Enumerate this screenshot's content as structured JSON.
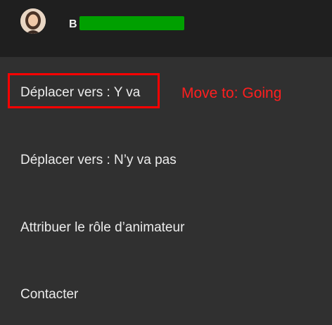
{
  "header": {
    "user_initial": "B",
    "avatar_icon": "user-avatar-photo"
  },
  "menu": {
    "items": [
      {
        "label": "Déplacer vers : Y va"
      },
      {
        "label": "Déplacer vers : N’y va pas"
      },
      {
        "label": "Attribuer le rôle d’animateur"
      },
      {
        "label": "Contacter"
      }
    ]
  },
  "annotation": {
    "text": "Move to: Going",
    "color": "#ff1f1f"
  },
  "colors": {
    "header_bg": "#1f1f1f",
    "menu_bg": "#303030",
    "redaction": "#00a000",
    "highlight": "#ff0000"
  }
}
